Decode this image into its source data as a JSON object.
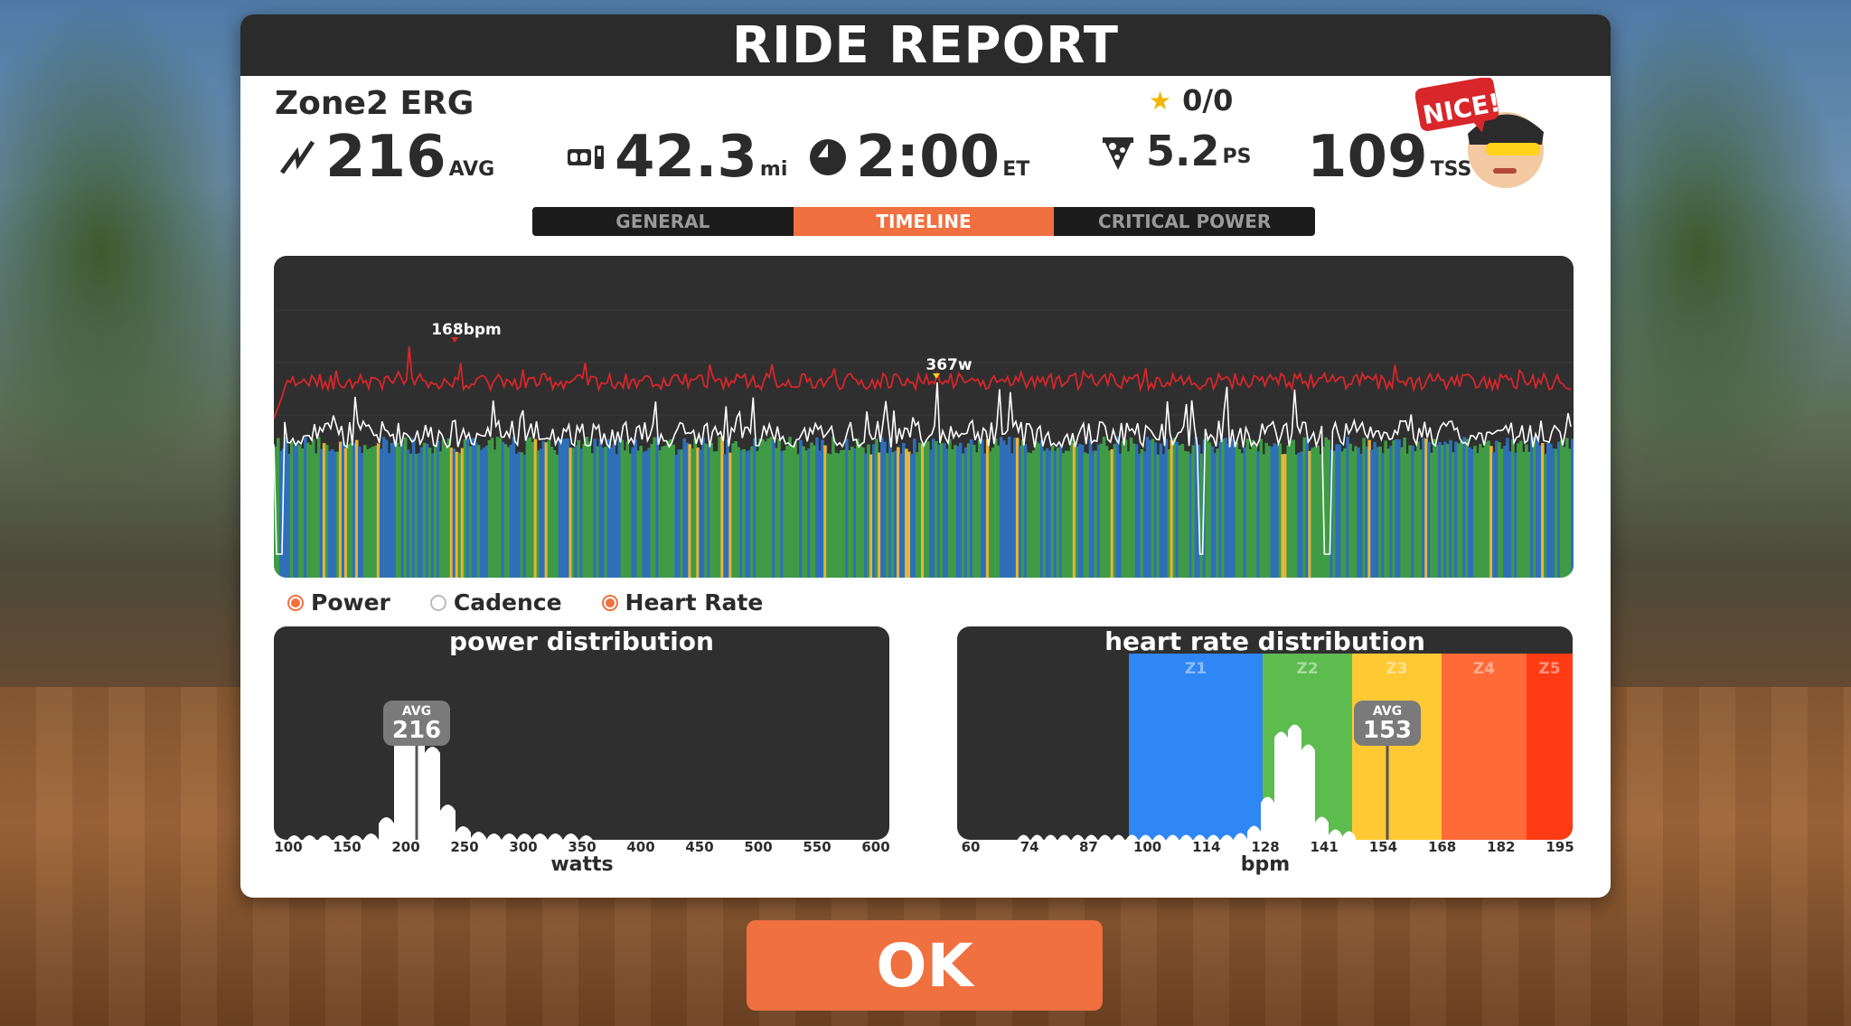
{
  "header": {
    "title": "RIDE REPORT"
  },
  "workout": {
    "name": "Zone2 ERG",
    "stars": "0/0"
  },
  "stats": {
    "power": {
      "icon": "lightning-icon",
      "value": "216",
      "unit": "AVG"
    },
    "distance": {
      "icon": "odometer-icon",
      "value": "42.3",
      "unit": "mi"
    },
    "time": {
      "icon": "clock-icon",
      "value": "2:00",
      "unit": "ET"
    },
    "pizza": {
      "icon": "pizza-icon",
      "value": "5.2",
      "unit": "PS"
    },
    "tss": {
      "value": "109",
      "unit": "TSS",
      "help": "?"
    }
  },
  "badge": {
    "text": "NICE!"
  },
  "tabs": [
    {
      "label": "GENERAL",
      "active": false
    },
    {
      "label": "TIMELINE",
      "active": true
    },
    {
      "label": "CRITICAL POWER",
      "active": false
    }
  ],
  "timeline": {
    "max_hr_label": "168bpm",
    "max_power_label": "367w",
    "colors": {
      "hr": "#d8262a",
      "power": "#ffffff",
      "zone_green": "#3f9b45",
      "zone_blue": "#2e6fb8",
      "zone_yellow": "#e7b43a"
    }
  },
  "toggles": [
    {
      "label": "Power",
      "on": true
    },
    {
      "label": "Cadence",
      "on": false
    },
    {
      "label": "Heart Rate",
      "on": true
    }
  ],
  "power_distribution": {
    "title": "power distribution",
    "avg_label": "AVG",
    "avg_value": "216",
    "xlabel": "watts",
    "ticks": [
      "100",
      "150",
      "200",
      "250",
      "300",
      "350",
      "400",
      "450",
      "500",
      "550",
      "600"
    ]
  },
  "hr_distribution": {
    "title": "heart rate distribution",
    "avg_label": "AVG",
    "avg_value": "153",
    "xlabel": "bpm",
    "ticks": [
      "60",
      "74",
      "87",
      "100",
      "114",
      "128",
      "141",
      "154",
      "168",
      "182",
      "195"
    ],
    "zones": [
      {
        "label": "Z1",
        "color": "#2f86f5"
      },
      {
        "label": "Z2",
        "color": "#5cbc4e"
      },
      {
        "label": "Z3",
        "color": "#ffc933"
      },
      {
        "label": "Z4",
        "color": "#ff6a38"
      },
      {
        "label": "Z5",
        "color": "#ff3b14"
      }
    ]
  },
  "ok_button": {
    "label": "OK"
  }
}
